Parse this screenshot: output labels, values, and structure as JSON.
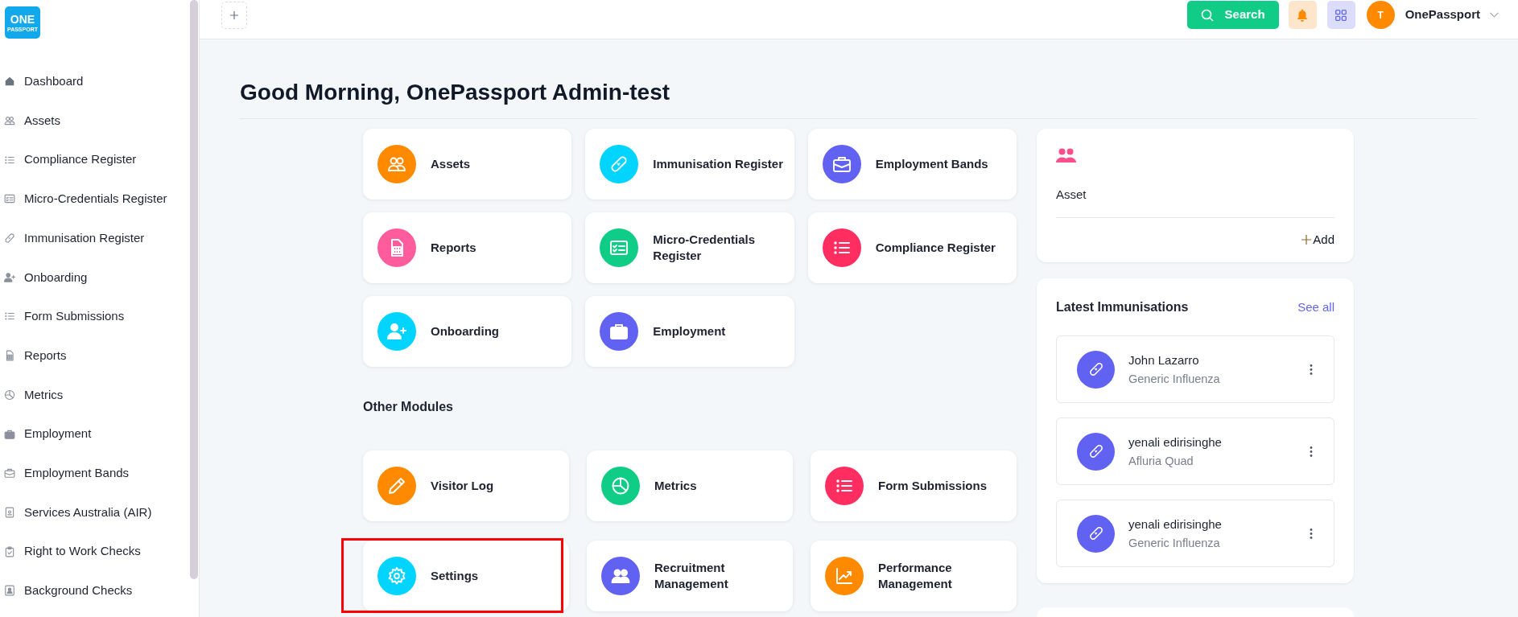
{
  "logo": {
    "line_1": "ONE",
    "line_2": "PASSPORT"
  },
  "sidebar": {
    "items": [
      {
        "label": "Dashboard"
      },
      {
        "label": "Assets"
      },
      {
        "label": "Compliance Register"
      },
      {
        "label": "Micro-Credentials Register"
      },
      {
        "label": "Immunisation Register"
      },
      {
        "label": "Onboarding"
      },
      {
        "label": "Form Submissions"
      },
      {
        "label": "Reports"
      },
      {
        "label": "Metrics"
      },
      {
        "label": "Employment"
      },
      {
        "label": "Employment Bands"
      },
      {
        "label": "Services Australia (AIR)"
      },
      {
        "label": "Right to Work Checks"
      },
      {
        "label": "Background Checks"
      }
    ]
  },
  "topbar": {
    "search_button": "Search",
    "avatar_initial": "T",
    "user_name": "OnePassport"
  },
  "greeting": "Good Morning, OnePassport Admin-test",
  "modules": [
    {
      "label": "Assets",
      "color": "#ff8a00"
    },
    {
      "label": "Immunisation Register",
      "color": "#00d4ff"
    },
    {
      "label": "Employment Bands",
      "color": "#6161f2"
    },
    {
      "label": "Reports",
      "color": "#ff5c9d"
    },
    {
      "label": "Micro-Credentials Register",
      "color": "#0fcd86"
    },
    {
      "label": "Compliance Register",
      "color": "#ff2d60"
    },
    {
      "label": "Onboarding",
      "color": "#00d4ff"
    },
    {
      "label": "Employment",
      "color": "#6161f2"
    }
  ],
  "other_modules": {
    "title": "Other Modules",
    "items": [
      {
        "label": "Visitor Log",
        "color": "#ff8a00",
        "highlighted": false
      },
      {
        "label": "Metrics",
        "color": "#0fcd86",
        "highlighted": false
      },
      {
        "label": "Form Submissions",
        "color": "#ff2d60",
        "highlighted": false
      },
      {
        "label": "Settings",
        "color": "#00d4ff",
        "highlighted": true
      },
      {
        "label": "Recruitment Management",
        "color": "#6161f2",
        "highlighted": false
      },
      {
        "label": "Performance Management",
        "color": "#ff8a00",
        "highlighted": false
      }
    ]
  },
  "asset_card": {
    "title": "Asset",
    "add_link": "Add"
  },
  "latest_immunisations": {
    "title": "Latest Immunisations",
    "see_all": "See all",
    "items": [
      {
        "name": "John Lazarro",
        "vaccine": "Generic Influenza"
      },
      {
        "name": "yenali edirisinghe",
        "vaccine": "Afluria Quad"
      },
      {
        "name": "yenali edirisinghe",
        "vaccine": "Generic Influenza"
      }
    ]
  }
}
